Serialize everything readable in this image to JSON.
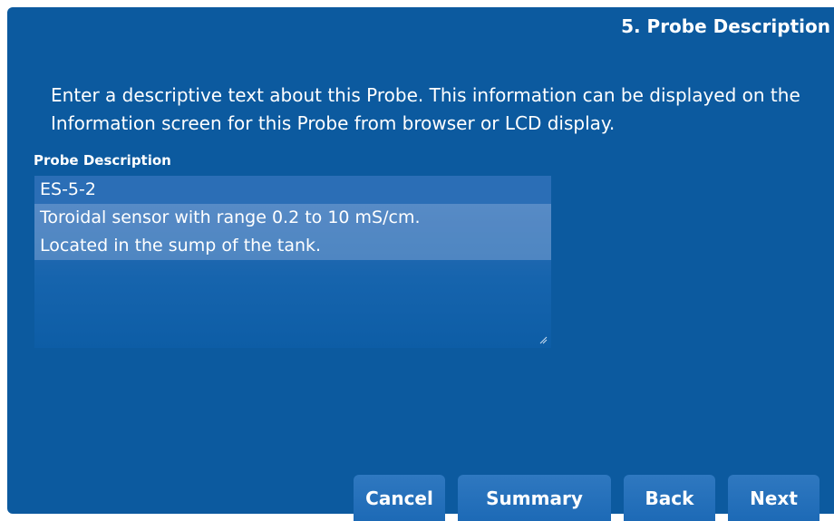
{
  "header": {
    "step_title": "5. Probe Description"
  },
  "instructions": {
    "text": "Enter a descriptive text about this Probe. This information can be displayed on the Information screen for this Probe from browser or LCD display."
  },
  "form": {
    "field_label": "Probe Description",
    "lines": [
      "ES-5-2",
      "Toroidal sensor with range 0.2 to 10 mS/cm.",
      "Located in the sump of the tank."
    ]
  },
  "buttons": {
    "cancel": "Cancel",
    "summary": "Summary",
    "back": "Back",
    "next": "Next"
  },
  "colors": {
    "panel": "#0c5a9f",
    "button": "#1d6ab6",
    "text": "#ffffff"
  }
}
